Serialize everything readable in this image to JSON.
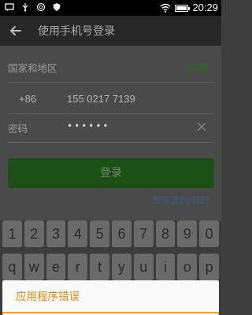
{
  "status_bar": {
    "left_icons": [
      "message-icon",
      "usb-icon",
      "sync-icon",
      "shield-icon"
    ],
    "right_icons": [
      "wifi-icon",
      "battery-icon"
    ],
    "time": "20:29"
  },
  "app_bar": {
    "title": "使用手机号登录"
  },
  "form": {
    "country_label": "国家和地区",
    "country_value": "中国",
    "country_code": "+86",
    "phone_number": "155 0217 7139",
    "password_label": "密码",
    "password_masked": "••••••",
    "login_button": "登录",
    "help_link": "登录遇到问题？"
  },
  "keyboard": {
    "row1": [
      "1",
      "2",
      "3",
      "4",
      "5",
      "6",
      "7",
      "8",
      "9",
      "0"
    ],
    "row2": [
      "q",
      "w",
      "e",
      "r",
      "t",
      "y",
      "u",
      "i",
      "o",
      "p"
    ]
  },
  "dialog": {
    "title": "应用程序错误"
  },
  "colors": {
    "accent_green": "#2e6b22",
    "dialog_orange": "#e08a12"
  }
}
